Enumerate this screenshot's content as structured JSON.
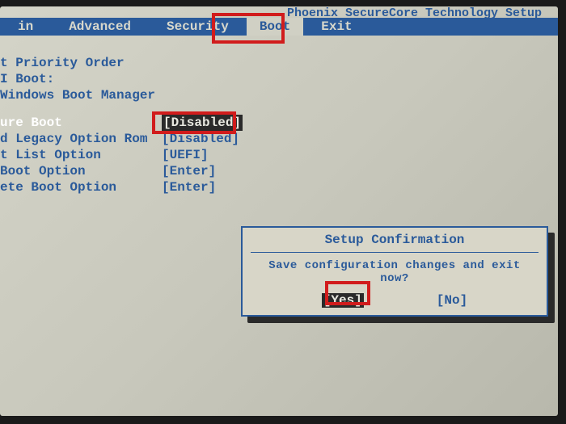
{
  "title": "Phoenix SecureCore Technology Setup",
  "menu": {
    "items": [
      {
        "label": "in"
      },
      {
        "label": "Advanced"
      },
      {
        "label": "Security"
      },
      {
        "label": "Boot",
        "active": true
      },
      {
        "label": "Exit"
      }
    ]
  },
  "content": {
    "lines": [
      {
        "label": "t Priority Order",
        "value": ""
      },
      {
        "label": "I Boot:",
        "value": ""
      },
      {
        "label": "Windows Boot Manager",
        "value": ""
      }
    ],
    "options": [
      {
        "label": "ure Boot",
        "value": "[Disabled]",
        "highlight": true
      },
      {
        "label": "d Legacy Option Rom",
        "value": "[Disabled]"
      },
      {
        "label": "t List Option",
        "value": "[UEFI]"
      },
      {
        "label": " Boot Option",
        "value": "[Enter]"
      },
      {
        "label": "ete Boot Option",
        "value": "[Enter]"
      }
    ]
  },
  "dialog": {
    "title": "Setup Confirmation",
    "message": "Save configuration changes and exit now?",
    "yes": "[Yes]",
    "no": "[No]"
  }
}
